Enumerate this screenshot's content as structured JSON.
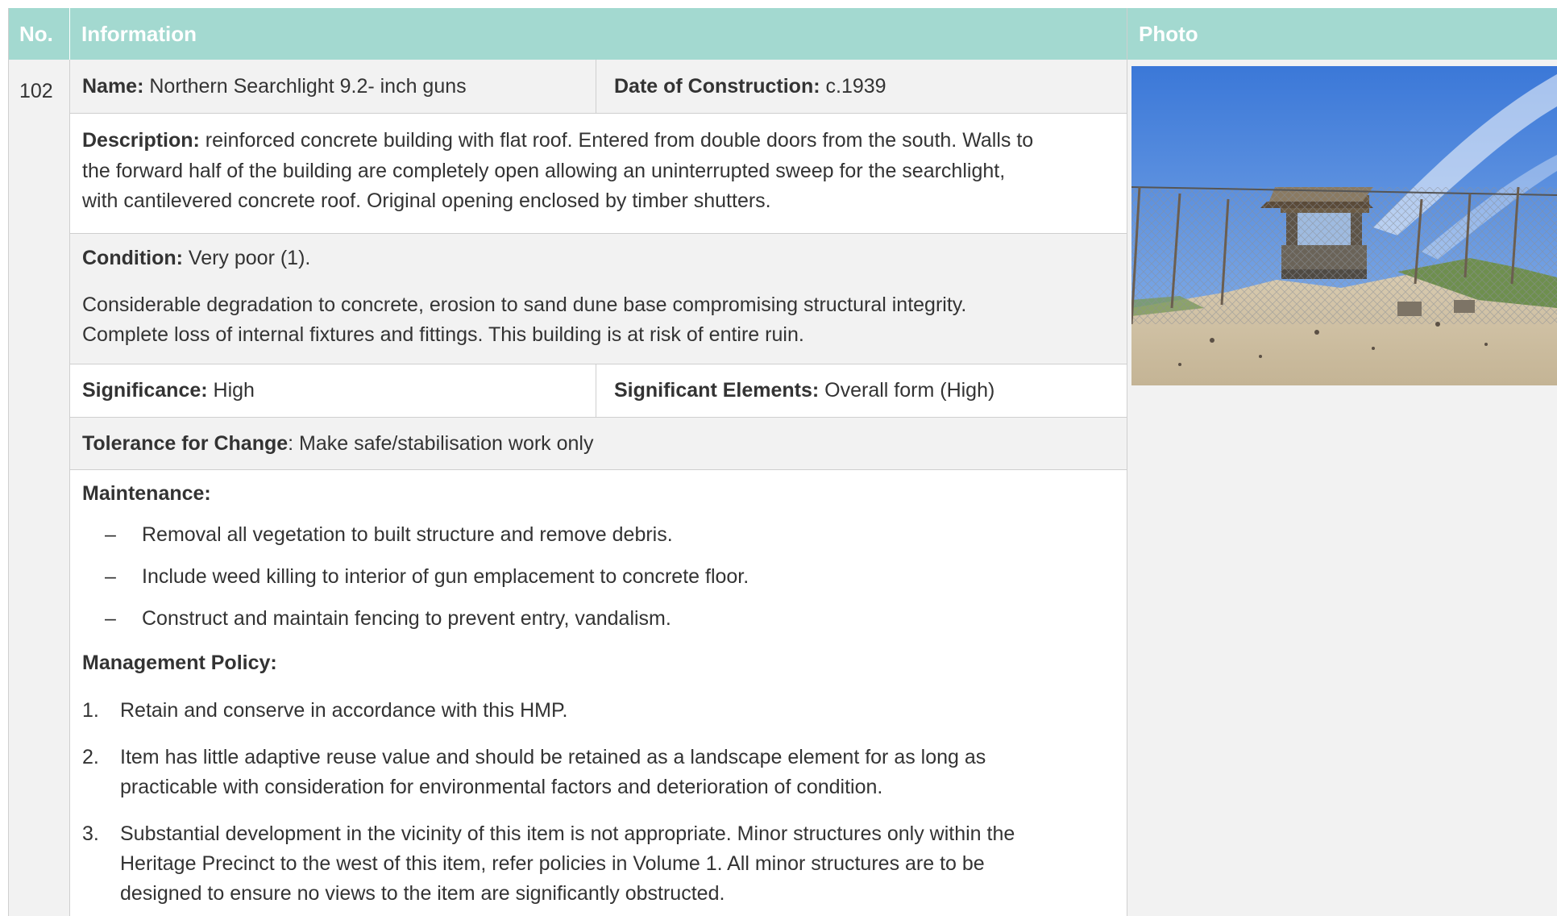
{
  "header": {
    "no": "No.",
    "information": "Information",
    "photo": "Photo"
  },
  "item": {
    "number": "102",
    "name_label": "Name:",
    "name_value": " Northern Searchlight 9.2- inch guns",
    "date_label": "Date of Construction:",
    "date_value": " c.1939",
    "description_label": "Description:",
    "description_lines": [
      " reinforced concrete building with flat roof. Entered from double doors from the south. Walls to",
      "the forward half of the building are completely open allowing an uninterrupted sweep for the searchlight,",
      "with cantilevered concrete roof. Original opening enclosed by timber shutters."
    ],
    "condition_label": "Condition:",
    "condition_value": " Very poor (1).",
    "condition_lines": [
      "Considerable degradation to concrete, erosion to sand dune base compromising structural integrity.",
      "Complete loss of internal fixtures and fittings. This building is at risk of entire ruin."
    ],
    "significance_label": "Significance:",
    "significance_value": " High",
    "elements_label": "Significant Elements:",
    "elements_value": " Overall form (High)",
    "tolerance_label": "Tolerance for Change",
    "tolerance_value": ":  Make safe/stabilisation work only",
    "maintenance_label": "Maintenance:",
    "maintenance_bullet": "–",
    "maintenance_items": [
      "Removal all vegetation to built structure and remove debris.",
      "Include weed killing to interior of gun emplacement to concrete floor.",
      "Construct and maintain fencing to prevent entry, vandalism."
    ],
    "policy_label": "Management Policy:",
    "policy_items": [
      {
        "num": "1.",
        "lines": [
          "Retain and conserve in accordance with this HMP."
        ]
      },
      {
        "num": "2.",
        "lines": [
          "Item has little adaptive reuse value and should be retained as a landscape element for as long as",
          "practicable with consideration for environmental factors and deterioration of condition."
        ]
      },
      {
        "num": "3.",
        "lines": [
          "Substantial development in the vicinity of this item is not appropriate. Minor structures only within the",
          "Heritage Precinct to the west of this item, refer policies in Volume 1. All minor structures are to be",
          "designed to ensure no views to the item are significantly obstructed."
        ]
      }
    ]
  },
  "colors": {
    "header_bg": "#a3d9d0",
    "header_text": "#ffffff",
    "gray_bg": "#f2f2f2",
    "text": "#333333"
  }
}
